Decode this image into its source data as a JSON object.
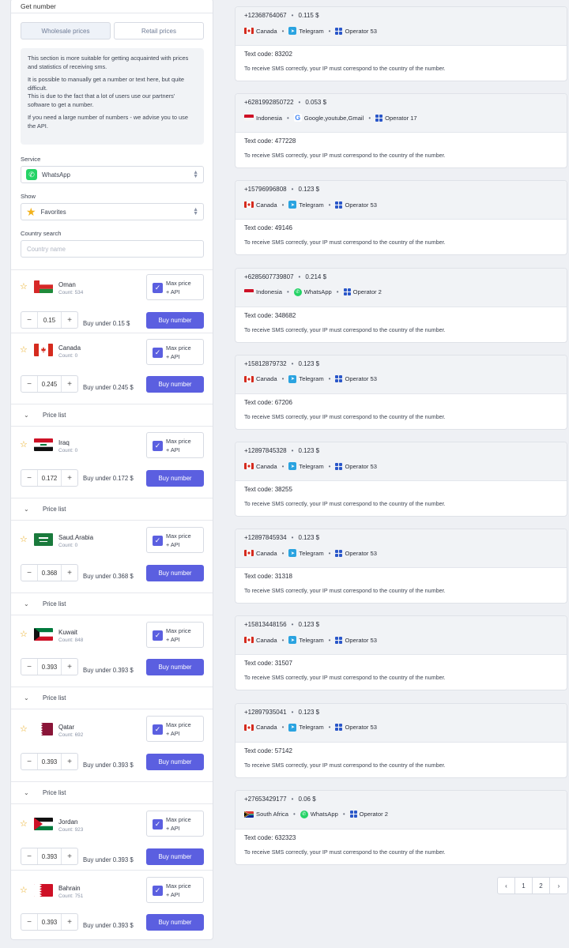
{
  "panel": {
    "title": "Get number"
  },
  "tabs": {
    "wholesale": "Wholesale prices",
    "retail": "Retail prices"
  },
  "info": {
    "p1": "This section is more suitable for getting acquainted with prices and statistics of receiving sms.",
    "p2": "It is possible to manually get a number or text here, but quite difficult.",
    "p3": "This is due to the fact that a lot of users use our partners' software to get a number.",
    "p4": "If you need a large number of numbers - we advise you to use the API."
  },
  "service": {
    "label": "Service",
    "value": "WhatsApp"
  },
  "show": {
    "label": "Show",
    "value": "Favorites"
  },
  "country_search": {
    "label": "Country search",
    "placeholder": "Country name"
  },
  "common": {
    "max_price": "Max price",
    "api": "+ API",
    "buy": "Buy number",
    "price_list": "Price list"
  },
  "countries": [
    {
      "name": "Oman",
      "count": "Count: 534",
      "price": "0.15",
      "buy_under": "Buy under 0.15 $"
    },
    {
      "name": "Canada",
      "count": "Count: 0",
      "price": "0.245",
      "buy_under": "Buy under 0.245 $"
    },
    {
      "name": "Iraq",
      "count": "Count: 0",
      "price": "0.172",
      "buy_under": "Buy under 0.172 $"
    },
    {
      "name": "Saud.Arabia",
      "count": "Count: 0",
      "price": "0.368",
      "buy_under": "Buy under 0.368 $"
    },
    {
      "name": "Kuwait",
      "count": "Count: 848",
      "price": "0.393",
      "buy_under": "Buy under 0.393 $"
    },
    {
      "name": "Qatar",
      "count": "Count: 692",
      "price": "0.393",
      "buy_under": "Buy under 0.393 $"
    },
    {
      "name": "Jordan",
      "count": "Count: 923",
      "price": "0.393",
      "buy_under": "Buy under 0.393 $"
    },
    {
      "name": "Bahrain",
      "count": "Count: 751",
      "price": "0.393",
      "buy_under": "Buy under 0.393 $"
    }
  ],
  "results": [
    {
      "number": "+12368764067",
      "price": "0.115 $",
      "country": "Canada",
      "service": "Telegram",
      "operator": "Operator 53",
      "code": "Text code: 83202"
    },
    {
      "number": "+6281992850722",
      "price": "0.053 $",
      "country": "Indonesia",
      "service": "Google,youtube,Gmail",
      "operator": "Operator 17",
      "code": "Text code: 477228"
    },
    {
      "number": "+15796996808",
      "price": "0.123 $",
      "country": "Canada",
      "service": "Telegram",
      "operator": "Operator 53",
      "code": "Text code: 49146"
    },
    {
      "number": "+6285607739807",
      "price": "0.214 $",
      "country": "Indonesia",
      "service": "WhatsApp",
      "operator": "Operator 2",
      "code": "Text code: 348682"
    },
    {
      "number": "+15812879732",
      "price": "0.123 $",
      "country": "Canada",
      "service": "Telegram",
      "operator": "Operator 53",
      "code": "Text code: 67206"
    },
    {
      "number": "+12897845328",
      "price": "0.123 $",
      "country": "Canada",
      "service": "Telegram",
      "operator": "Operator 53",
      "code": "Text code: 38255"
    },
    {
      "number": "+12897845934",
      "price": "0.123 $",
      "country": "Canada",
      "service": "Telegram",
      "operator": "Operator 53",
      "code": "Text code: 31318"
    },
    {
      "number": "+15813448156",
      "price": "0.123 $",
      "country": "Canada",
      "service": "Telegram",
      "operator": "Operator 53",
      "code": "Text code: 31507"
    },
    {
      "number": "+12897935041",
      "price": "0.123 $",
      "country": "Canada",
      "service": "Telegram",
      "operator": "Operator 53",
      "code": "Text code: 57142"
    },
    {
      "number": "+27653429177",
      "price": "0.06 $",
      "country": "South Africa",
      "service": "WhatsApp",
      "operator": "Operator 2",
      "code": "Text code: 632323"
    }
  ],
  "result_note": "To receive SMS correctly, your IP must correspond to the country of the number.",
  "pagination": {
    "prev": "‹",
    "p1": "1",
    "p2": "2",
    "next": "›"
  },
  "colors": {
    "accent": "#5b5fe0",
    "whatsapp": "#25d366",
    "telegram": "#2aa3e0",
    "star": "#f2b21c"
  }
}
